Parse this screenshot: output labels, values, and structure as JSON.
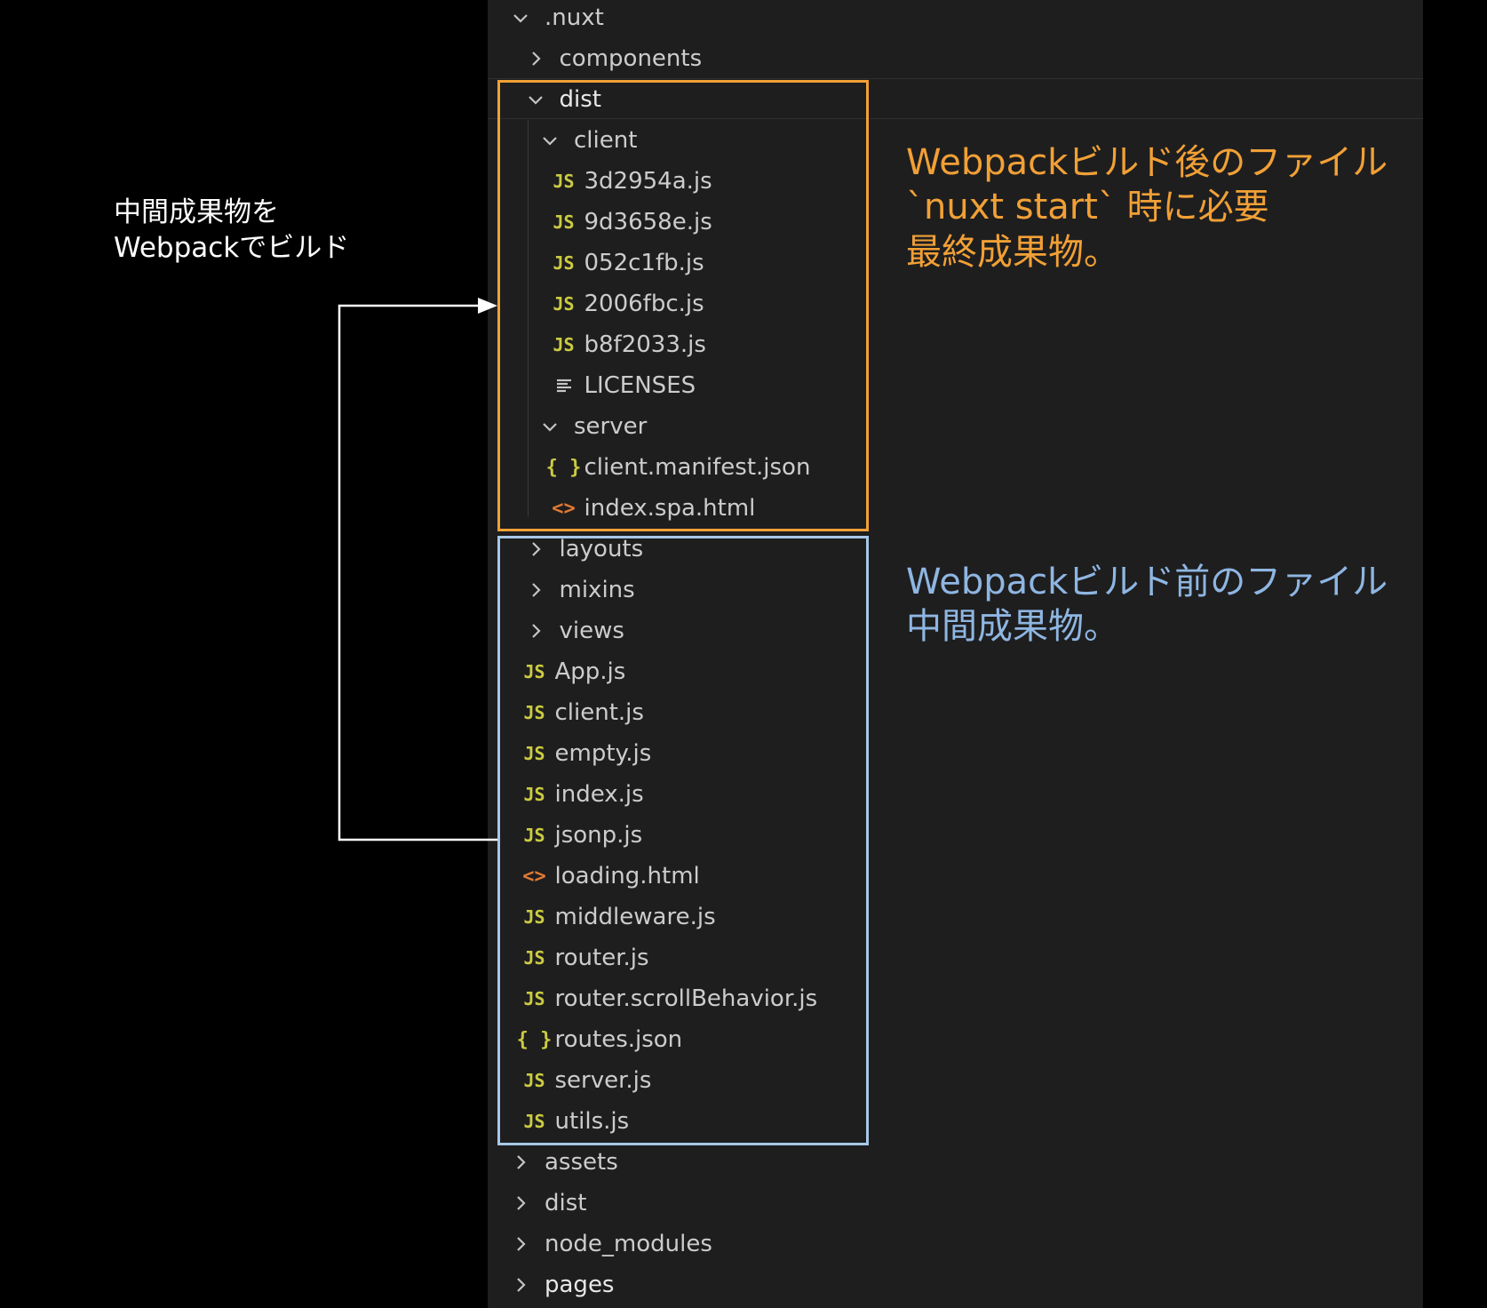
{
  "explorer": {
    "items": [
      {
        "label": ".nuxt",
        "kind": "folder-open",
        "depth": 0,
        "icon": "chevron-down-icon"
      },
      {
        "label": "components",
        "kind": "folder-closed",
        "depth": 1,
        "icon": "chevron-right-icon"
      },
      {
        "label": "dist",
        "kind": "folder-open",
        "depth": 1,
        "icon": "chevron-down-icon"
      },
      {
        "label": "client",
        "kind": "folder-open",
        "depth": 2,
        "icon": "chevron-down-icon"
      },
      {
        "label": "3d2954a.js",
        "kind": "js",
        "depth": 3,
        "icon": "js-file-icon"
      },
      {
        "label": "9d3658e.js",
        "kind": "js",
        "depth": 3,
        "icon": "js-file-icon"
      },
      {
        "label": "052c1fb.js",
        "kind": "js",
        "depth": 3,
        "icon": "js-file-icon"
      },
      {
        "label": "2006fbc.js",
        "kind": "js",
        "depth": 3,
        "icon": "js-file-icon"
      },
      {
        "label": "b8f2033.js",
        "kind": "js",
        "depth": 3,
        "icon": "js-file-icon"
      },
      {
        "label": "LICENSES",
        "kind": "txt",
        "depth": 3,
        "icon": "text-file-icon"
      },
      {
        "label": "server",
        "kind": "folder-open",
        "depth": 2,
        "icon": "chevron-down-icon"
      },
      {
        "label": "client.manifest.json",
        "kind": "json",
        "depth": 3,
        "icon": "json-file-icon"
      },
      {
        "label": "index.spa.html",
        "kind": "html",
        "depth": 3,
        "icon": "html-file-icon"
      },
      {
        "label": "layouts",
        "kind": "folder-closed",
        "depth": 1,
        "icon": "chevron-right-icon"
      },
      {
        "label": "mixins",
        "kind": "folder-closed",
        "depth": 1,
        "icon": "chevron-right-icon"
      },
      {
        "label": "views",
        "kind": "folder-closed",
        "depth": 1,
        "icon": "chevron-right-icon"
      },
      {
        "label": "App.js",
        "kind": "js",
        "depth": 1,
        "icon": "js-file-icon"
      },
      {
        "label": "client.js",
        "kind": "js",
        "depth": 1,
        "icon": "js-file-icon"
      },
      {
        "label": "empty.js",
        "kind": "js",
        "depth": 1,
        "icon": "js-file-icon"
      },
      {
        "label": "index.js",
        "kind": "js",
        "depth": 1,
        "icon": "js-file-icon"
      },
      {
        "label": "jsonp.js",
        "kind": "js",
        "depth": 1,
        "icon": "js-file-icon"
      },
      {
        "label": "loading.html",
        "kind": "html",
        "depth": 1,
        "icon": "html-file-icon"
      },
      {
        "label": "middleware.js",
        "kind": "js",
        "depth": 1,
        "icon": "js-file-icon"
      },
      {
        "label": "router.js",
        "kind": "js",
        "depth": 1,
        "icon": "js-file-icon"
      },
      {
        "label": "router.scrollBehavior.js",
        "kind": "js",
        "depth": 1,
        "icon": "js-file-icon"
      },
      {
        "label": "routes.json",
        "kind": "json",
        "depth": 1,
        "icon": "json-file-icon"
      },
      {
        "label": "server.js",
        "kind": "js",
        "depth": 1,
        "icon": "js-file-icon"
      },
      {
        "label": "utils.js",
        "kind": "js",
        "depth": 1,
        "icon": "js-file-icon"
      },
      {
        "label": "assets",
        "kind": "folder-closed",
        "depth": 0,
        "icon": "chevron-right-icon"
      },
      {
        "label": "dist",
        "kind": "folder-closed",
        "depth": 0,
        "icon": "chevron-right-icon"
      },
      {
        "label": "node_modules",
        "kind": "folder-closed",
        "depth": 0,
        "icon": "chevron-right-icon"
      },
      {
        "label": "pages",
        "kind": "folder-closed",
        "depth": 0,
        "icon": "chevron-right-icon"
      }
    ]
  },
  "icon_glyphs": {
    "js": "JS",
    "json": "{ }",
    "html": "<>"
  },
  "annotations": {
    "after_build": {
      "line1": "Webpackビルド後のファイル",
      "line2": "`nuxt start` 時に必要",
      "line3": "最終成果物。",
      "color": "#f1a036"
    },
    "before_build": {
      "line1": "Webpackビルド前のファイル",
      "line2": "中間成果物。",
      "color": "#8fb6e2"
    },
    "arrow_note": {
      "line1": "中間成果物を",
      "line2": "Webpackでビルド"
    }
  },
  "colors": {
    "panel_bg": "#1e1e1f",
    "js_icon": "#cbcb41",
    "html_icon": "#e37933",
    "text": "#cccccc"
  }
}
